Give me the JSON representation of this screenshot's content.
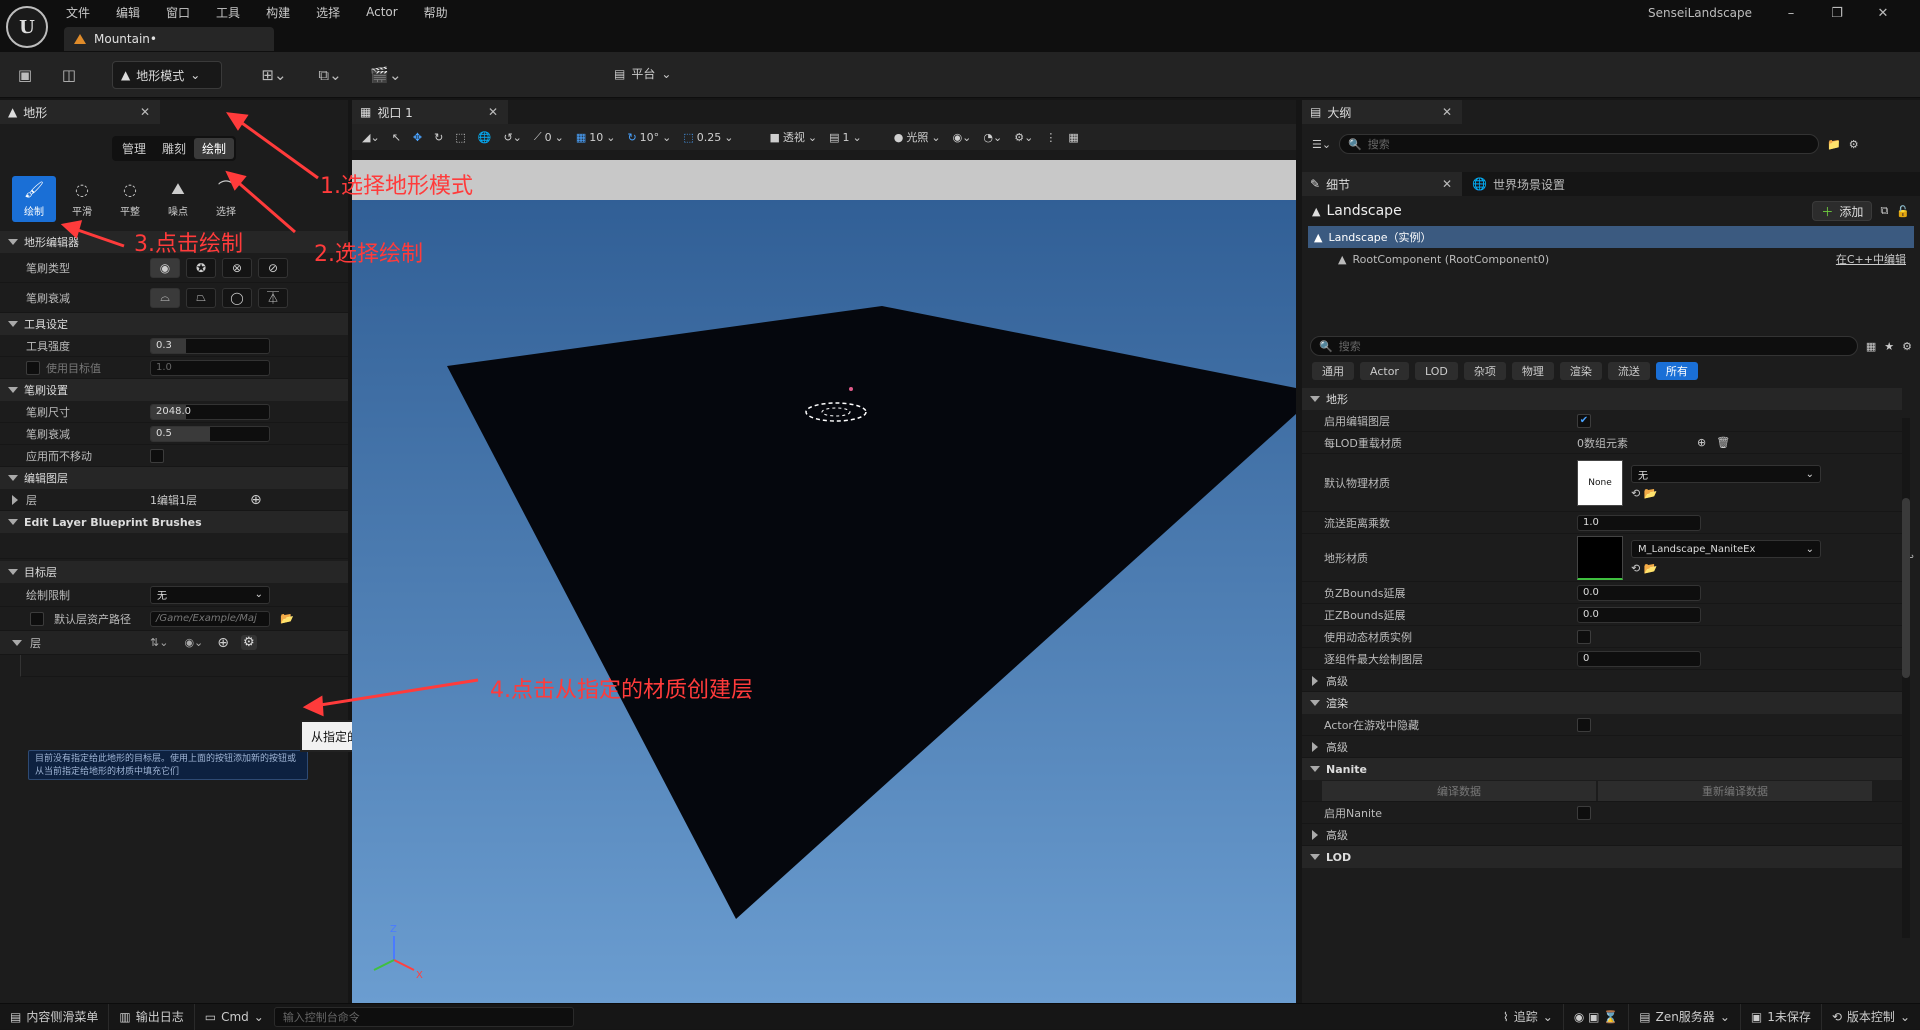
{
  "menu": [
    "文件",
    "编辑",
    "窗口",
    "工具",
    "构建",
    "选择",
    "Actor",
    "帮助"
  ],
  "project_tab": "Mountain•",
  "app_title": "SenseiLandscape",
  "toolbar": {
    "mode_label": "地形模式",
    "platform_label": "平台"
  },
  "left": {
    "tab": "地形",
    "modes": [
      "管理",
      "雕刻",
      "绘制"
    ],
    "tools": [
      "绘制",
      "平滑",
      "平整",
      "噪点",
      "选择"
    ],
    "sec_editor": "地形编辑器",
    "brush_type": "笔刷类型",
    "brush_falloff": "笔刷衰减",
    "sec_tool": "工具设定",
    "strength_label": "工具强度",
    "strength_value": "0.3",
    "use_target": "使用目标值",
    "target_value": "1.0",
    "sec_brush": "笔刷设置",
    "size_label": "笔刷尺寸",
    "size_value": "2048.0",
    "falloff_label": "笔刷衰减",
    "falloff_value": "0.5",
    "apply_label": "应用而不移动",
    "sec_edit_layers": "编辑图层",
    "layer_label": "层",
    "layer_value": "1编辑1层",
    "sec_bp": "Edit Layer Blueprint Brushes",
    "sec_target": "目标层",
    "paint_limit": "绘制限制",
    "paint_limit_value": "无",
    "default_path_label": "默认层资产路径",
    "default_path_value": "/Game/Example/Maj",
    "layers_label": "层",
    "tooltip": "从指定的材质创建层",
    "info": "目前没有指定给此地形的目标层。使用上面的按钮添加新的按钮或从当前指定给地形的材质中填充它们"
  },
  "annotations": [
    "1.选择地形模式",
    "2.选择绘制",
    "3.点击绘制",
    "4.点击从指定的材质创建层"
  ],
  "viewport": {
    "tab": "视口 1",
    "snap_move": "10",
    "snap_rot": "10°",
    "snap_scale": "0.25",
    "count0": "0",
    "view": "透视",
    "lighting": "光照",
    "count1": "1"
  },
  "outline": {
    "tab": "大纲",
    "search": "搜索"
  },
  "details": {
    "tab": "细节",
    "tab2": "世界场景设置",
    "title": "Landscape",
    "add": "添加",
    "instance": "Landscape（实例）",
    "root": "RootComponent (RootComponent0)",
    "edit_cpp": "在C++中编辑",
    "search": "搜索",
    "filters": [
      "通用",
      "Actor",
      "LOD",
      "杂项",
      "物理",
      "渲染",
      "流送",
      "所有"
    ],
    "sec_landscape": "地形",
    "enable_layers": "启用编辑图层",
    "lod_mat": "每LOD重载材质",
    "lod_mat_value": "0数组元素",
    "phys_mat": "默认物理材质",
    "phys_thumb": "None",
    "phys_value": "无",
    "stream_dist": "流送距离乘数",
    "stream_value": "1.0",
    "land_mat": "地形材质",
    "land_mat_value": "M_Landscape_NaniteEx",
    "negz": "负ZBounds延展",
    "negz_value": "0.0",
    "posz": "正ZBounds延展",
    "posz_value": "0.0",
    "dyn_mat": "使用动态材质实例",
    "max_layers": "逐组件最大绘制图层",
    "max_layers_value": "0",
    "adv": "高级",
    "sec_render": "渲染",
    "hidden": "Actor在游戏中隐藏",
    "sec_nanite": "Nanite",
    "compile": "编译数据",
    "recompile": "重新编译数据",
    "enable_nanite": "启用Nanite",
    "sec_lod": "LOD"
  },
  "status": {
    "content": "内容侧滑菜单",
    "output": "输出日志",
    "cmd": "Cmd",
    "cmd_placeholder": "输入控制台命令",
    "trace": "追踪",
    "zen": "Zen服务器",
    "unsaved": "1未保存",
    "vc": "版本控制"
  }
}
